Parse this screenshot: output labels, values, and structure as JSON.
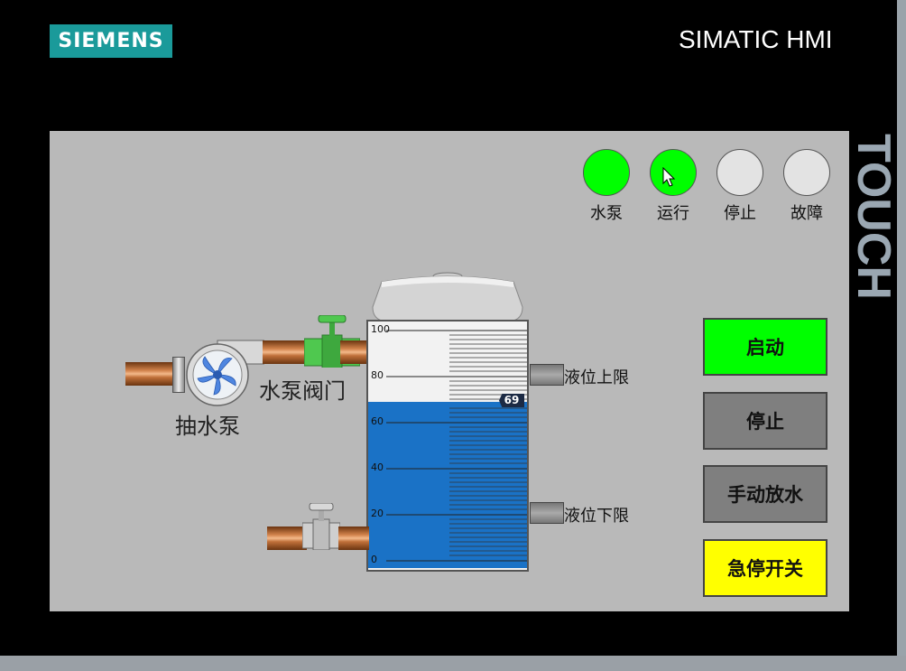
{
  "header": {
    "logo": "SIEMENS",
    "brand": "SIMATIC HMI",
    "side_text": "TOUCH"
  },
  "indicators": [
    {
      "label": "水泵",
      "state": "on"
    },
    {
      "label": "运行",
      "state": "on"
    },
    {
      "label": "停止",
      "state": "off"
    },
    {
      "label": "故障",
      "state": "off"
    }
  ],
  "buttons": {
    "start": {
      "label": "启动",
      "color": "#00ff00"
    },
    "stop": {
      "label": "停止",
      "color": "#7f7f7f"
    },
    "manual_drain": {
      "label": "手动放水",
      "color": "#7f7f7f"
    },
    "emergency": {
      "label": "急停开关",
      "color": "#ffff00"
    }
  },
  "process": {
    "pump_label": "抽水泵",
    "valve_label": "水泵阀门",
    "upper_limit_label": "液位上限",
    "lower_limit_label": "液位下限"
  },
  "tank": {
    "level": 69,
    "level_text": "69",
    "scale_min": 0,
    "scale_max": 100,
    "ticks": [
      "100",
      "80",
      "60",
      "40",
      "20",
      "0"
    ],
    "water_color": "#1a72c6"
  },
  "colors": {
    "lamp_on": "#00ff00",
    "lamp_off": "#e3e3e3",
    "valve_green": "#4fc84f",
    "pump_blue": "#4f86e0"
  }
}
